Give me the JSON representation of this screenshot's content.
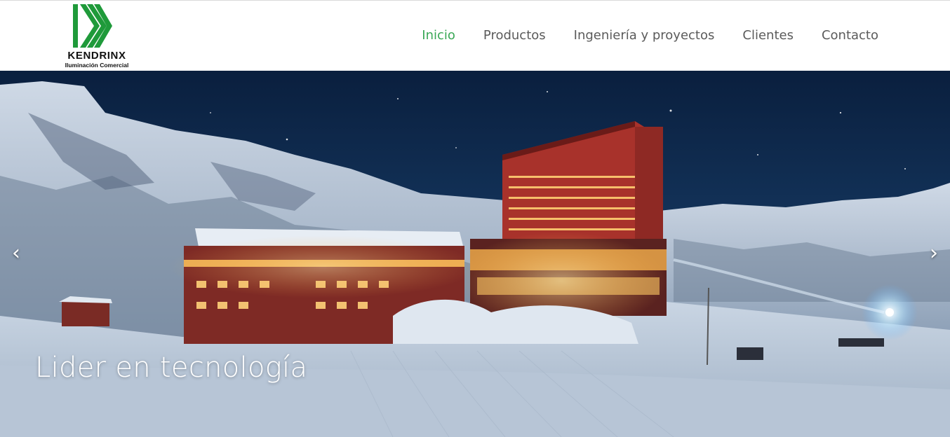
{
  "brand": {
    "name": "KENDRINX",
    "tagline": "Iluminación Comercial",
    "logo_color": "#1f9a3a"
  },
  "nav": {
    "items": [
      {
        "label": "Inicio",
        "active": true
      },
      {
        "label": "Productos",
        "active": false
      },
      {
        "label": "Ingeniería y proyectos",
        "active": false
      },
      {
        "label": "Clientes",
        "active": false
      },
      {
        "label": "Contacto",
        "active": false
      }
    ],
    "active_color": "#3aa856",
    "text_color": "#5b5b5b"
  },
  "hero": {
    "caption": "Lider en tecnología",
    "prev_icon": "chevron-left-icon",
    "next_icon": "chevron-right-icon",
    "prev_glyph": "‹",
    "next_glyph": "›"
  }
}
